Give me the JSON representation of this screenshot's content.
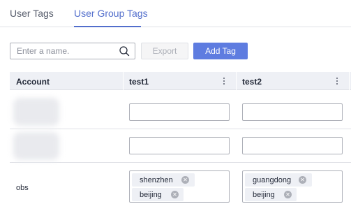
{
  "tabs": [
    {
      "label": "User Tags"
    },
    {
      "label": "User Group Tags"
    }
  ],
  "toolbar": {
    "search_placeholder": "Enter a name.",
    "export_label": "Export",
    "add_tag_label": "Add Tag"
  },
  "table": {
    "headers": [
      "Account",
      "test1",
      "test2"
    ],
    "rows": [
      {
        "account": "",
        "test1": [],
        "test2": []
      },
      {
        "account": "",
        "test1": [],
        "test2": []
      },
      {
        "account": "obs",
        "test1": [
          "shenzhen",
          "beijing"
        ],
        "test2": [
          "guangdong",
          "beijing"
        ]
      }
    ]
  },
  "colors": {
    "accent": "#526ecc",
    "primary_button": "#5e7ce0",
    "header_bg": "#eef0f5"
  }
}
